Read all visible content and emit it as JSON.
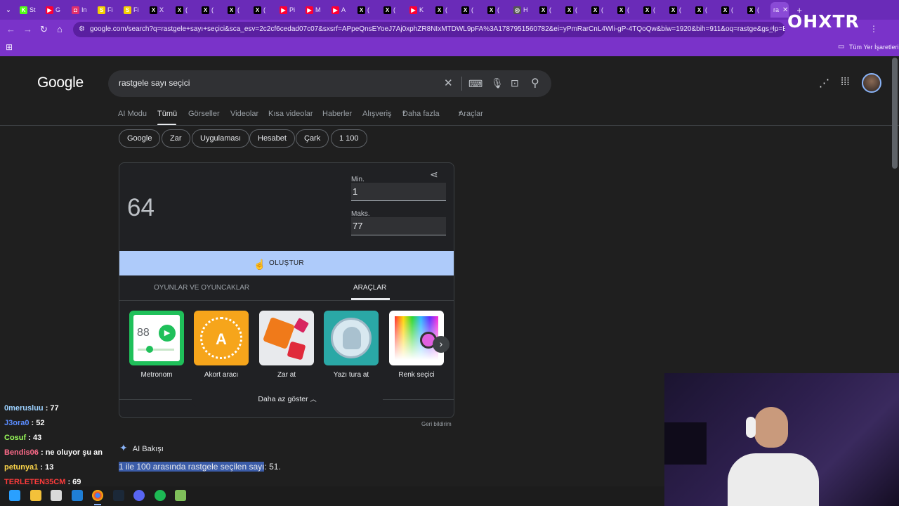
{
  "browser": {
    "tabs": [
      {
        "label": "St",
        "icon": "k-icon",
        "color": "#53fc18"
      },
      {
        "label": "G",
        "icon": "youtube-icon",
        "color": "#ff0033"
      },
      {
        "label": "In",
        "icon": "instagram-icon",
        "color": "#e1306c"
      },
      {
        "label": "Fi",
        "icon": "s-icon",
        "color": "#f5d000"
      },
      {
        "label": "Fi",
        "icon": "s-icon",
        "color": "#f5d000"
      },
      {
        "label": "X",
        "icon": "x-icon",
        "color": "#000000"
      },
      {
        "label": "(",
        "icon": "x-icon",
        "color": "#000000"
      },
      {
        "label": "(",
        "icon": "x-icon",
        "color": "#000000"
      },
      {
        "label": "(",
        "icon": "x-icon",
        "color": "#000000"
      },
      {
        "label": "(",
        "icon": "x-icon",
        "color": "#000000"
      },
      {
        "label": "Pi",
        "icon": "youtube-icon",
        "color": "#ff0033"
      },
      {
        "label": "M",
        "icon": "youtube-icon",
        "color": "#ff0033"
      },
      {
        "label": "A",
        "icon": "youtube-icon",
        "color": "#ff0033"
      },
      {
        "label": "(",
        "icon": "x-icon",
        "color": "#000000"
      },
      {
        "label": "(",
        "icon": "x-icon",
        "color": "#000000"
      },
      {
        "label": "K",
        "icon": "youtube-icon",
        "color": "#ff0033"
      },
      {
        "label": "(",
        "icon": "x-icon",
        "color": "#000000"
      },
      {
        "label": "(",
        "icon": "x-icon",
        "color": "#000000"
      },
      {
        "label": "(",
        "icon": "x-icon",
        "color": "#000000"
      },
      {
        "label": "H",
        "icon": "globe-icon",
        "color": "#555555"
      },
      {
        "label": "(",
        "icon": "x-icon",
        "color": "#000000"
      },
      {
        "label": "(",
        "icon": "x-icon",
        "color": "#000000"
      },
      {
        "label": "(",
        "icon": "x-icon",
        "color": "#000000"
      },
      {
        "label": "(",
        "icon": "x-icon",
        "color": "#000000"
      },
      {
        "label": "(",
        "icon": "x-icon",
        "color": "#000000"
      },
      {
        "label": "(",
        "icon": "x-icon",
        "color": "#000000"
      },
      {
        "label": "(",
        "icon": "x-icon",
        "color": "#000000"
      },
      {
        "label": "(",
        "icon": "x-icon",
        "color": "#000000"
      },
      {
        "label": "(",
        "icon": "x-icon",
        "color": "#000000"
      }
    ],
    "active_tab_label": "ra",
    "url": "google.com/search?q=rastgele+sayı+seçici&sca_esv=2c2cf6cedad07c07&sxsrf=APpeQnsEYoeJ7Aj0xphZR8NIxMTDWL9pFA%3A1787951560782&ei=yPmRarCnL4Wli-gP-4TQoQw&biw=1920&bih=911&oq=rastge&gs_lp=Egxnd3Mt...",
    "bookmarks_label": "Tüm Yer İşaretleri"
  },
  "google": {
    "logo": "Google",
    "query": "rastgele sayı seçici",
    "nav": [
      "AI Modu",
      "Tümü",
      "Görseller",
      "Videolar",
      "Kısa videolar",
      "Haberler",
      "Alışveriş",
      "Daha fazla",
      "Araçlar"
    ],
    "chips": [
      "Google",
      "Zar",
      "Uygulaması",
      "Hesabet",
      "Çark",
      "1 100"
    ]
  },
  "widget": {
    "result": "64",
    "min_label": "Min.",
    "min_value": "1",
    "max_label": "Maks.",
    "max_value": "77",
    "generate_label": "OLUŞTUR",
    "tabs": [
      "OYUNLAR VE OYUNCAKLAR",
      "ARAÇLAR"
    ],
    "tools": [
      {
        "label": "Metronom",
        "display": "88"
      },
      {
        "label": "Akort aracı",
        "display": "A"
      },
      {
        "label": "Zar at"
      },
      {
        "label": "Yazı tura at"
      },
      {
        "label": "Renk seçici"
      }
    ],
    "show_less": "Daha az göster",
    "feedback": "Geri bildirim"
  },
  "ai": {
    "title": "AI Bakışı",
    "highlight": "1 ile 100 arasında rastgele seçilen sayı",
    "rest": ": 51."
  },
  "chat": [
    {
      "user": "0merusluu",
      "msg": " : 77",
      "color": "#9cd1ff"
    },
    {
      "user": "J3ora0",
      "msg": " : 52",
      "color": "#5a8cff"
    },
    {
      "user": "Cosuf",
      "msg": " : 43",
      "color": "#9bff5a"
    },
    {
      "user": "Bendis06",
      "msg": " : ne oluyor şu an",
      "color": "#ff6b8a"
    },
    {
      "user": "petunya1",
      "msg": " : 13",
      "color": "#ffd84a"
    },
    {
      "user": "TERLETEN35CM",
      "msg": " : 69",
      "color": "#ff3b3b"
    }
  ],
  "watermark": "OHXTR"
}
